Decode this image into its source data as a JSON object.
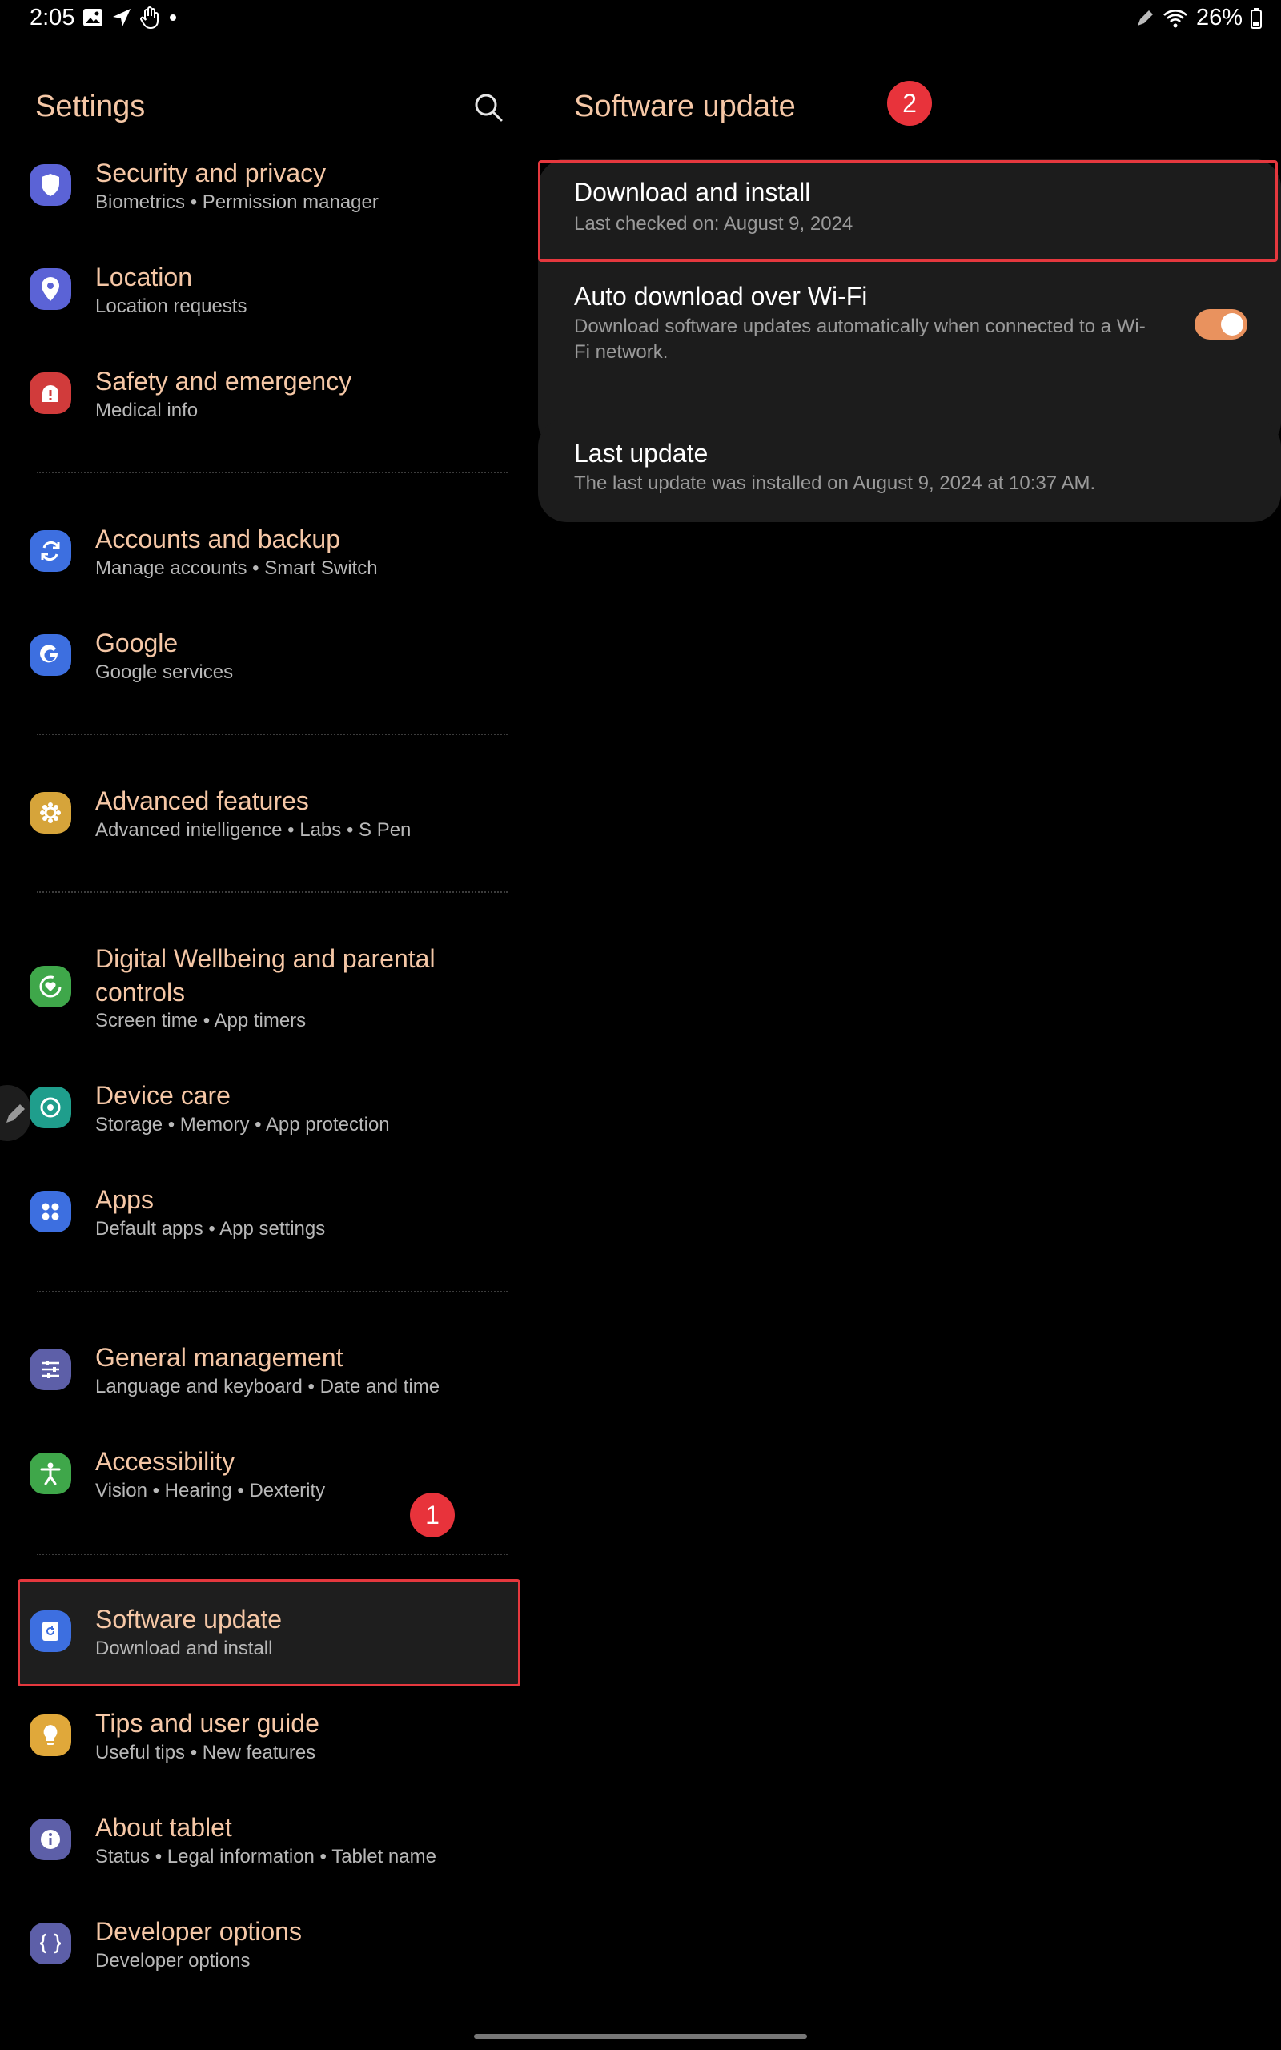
{
  "status_bar": {
    "time": "2:05",
    "battery": "26%"
  },
  "left": {
    "title": "Settings",
    "items": [
      {
        "title": "Security and privacy",
        "subtitle": "Biometrics  •  Permission manager",
        "icon": "shield-icon",
        "color": "#5b63d6"
      },
      {
        "title": "Location",
        "subtitle": "Location requests",
        "icon": "location-pin-icon",
        "color": "#5b63d6"
      },
      {
        "title": "Safety and emergency",
        "subtitle": "Medical info",
        "icon": "emergency-alert-icon",
        "color": "#d13b3b"
      },
      {
        "title": "Accounts and backup",
        "subtitle": "Manage accounts  •  Smart Switch",
        "icon": "sync-icon",
        "color": "#3d6fe0"
      },
      {
        "title": "Google",
        "subtitle": "Google services",
        "icon": "google-g-icon",
        "color": "#3d6fe0"
      },
      {
        "title": "Advanced features",
        "subtitle": "Advanced intelligence  •  Labs  •  S Pen",
        "icon": "puzzle-gear-icon",
        "color": "#d6a43a"
      },
      {
        "title": "Digital Wellbeing and parental controls",
        "subtitle": "Screen time  •  App timers",
        "icon": "wellbeing-heart-icon",
        "color": "#3fa74a"
      },
      {
        "title": "Device care",
        "subtitle": "Storage  •  Memory  •  App protection",
        "icon": "device-care-icon",
        "color": "#1f9e8c"
      },
      {
        "title": "Apps",
        "subtitle": "Default apps  •  App settings",
        "icon": "apps-grid-icon",
        "color": "#3d6fe0"
      },
      {
        "title": "General management",
        "subtitle": "Language and keyboard  •  Date and time",
        "icon": "sliders-icon",
        "color": "#5d5fa8"
      },
      {
        "title": "Accessibility",
        "subtitle": "Vision  •  Hearing  •  Dexterity",
        "icon": "accessibility-person-icon",
        "color": "#3fa74a"
      },
      {
        "title": "Software update",
        "subtitle": "Download and install",
        "icon": "software-update-icon",
        "color": "#3d6fe0"
      },
      {
        "title": "Tips and user guide",
        "subtitle": "Useful tips  •  New features",
        "icon": "lightbulb-icon",
        "color": "#e0a83a"
      },
      {
        "title": "About tablet",
        "subtitle": "Status  •  Legal information  •  Tablet name",
        "icon": "info-icon",
        "color": "#5d5fa8"
      },
      {
        "title": "Developer options",
        "subtitle": "Developer options",
        "icon": "braces-icon",
        "color": "#5d5fa8"
      }
    ],
    "badge": "1"
  },
  "right": {
    "title": "Software update",
    "badge": "2",
    "download": {
      "title": "Download and install",
      "subtitle": "Last checked on: August 9, 2024"
    },
    "auto": {
      "title": "Auto download over Wi-Fi",
      "subtitle": "Download software updates automatically when connected to a Wi-Fi network.",
      "toggle_on": true
    },
    "last": {
      "title": "Last update",
      "subtitle": "The last update was installed on August 9, 2024 at 10:37 AM."
    }
  },
  "colors": {
    "accent_title": "#f5c7a6",
    "highlight_red": "#e5383e",
    "toggle_on": "#e9925e"
  }
}
